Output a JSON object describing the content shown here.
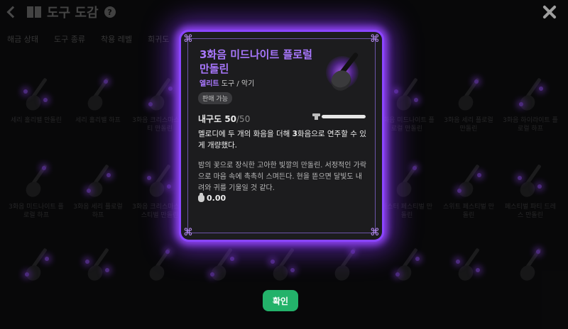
{
  "header": {
    "title": "도구 도감",
    "help_icon": "help-circle-icon",
    "back_icon": "chevron-left-icon",
    "close_icon": "close-icon"
  },
  "filters": [
    "해금 상태",
    "도구 종류",
    "착용 레벨",
    "희귀도"
  ],
  "grid": {
    "rows": [
      [
        "세리 홀리밸 만돌린",
        "세리 홀리밸 하프",
        "3화음 크리스마스 파티 만돌린",
        "",
        "",
        "",
        "3화음 미드나이트 플로럴 만돌린",
        "3화음 세리 플로럴 만돌린",
        "3화음 하이라이트 플로럴 하프"
      ],
      [
        "3화음 미드나이트 플로럴 하프",
        "3화음 세리 플로럴 하프",
        "3화음 크리스마스 페스티벌 만돌린",
        "",
        "",
        "",
        "마스터 페스티벌 만돌린",
        "스위트 페스티벌 만돌린",
        "페스티벌 파티 드레스 만돌린"
      ],
      [
        "",
        "",
        "",
        "",
        "",
        "",
        "",
        "",
        ""
      ]
    ]
  },
  "item": {
    "name": "3화음 미드나이트 플로럴 만돌린",
    "grade": "엘리트",
    "category_rest": " 도구 / 악기",
    "sell_badge": "판매 가능",
    "durability_label": "내구도 ",
    "durability_current": "50",
    "durability_max": "/50",
    "durability_fraction": 1.0,
    "desc1_pre": "멜로디에 두 개의 화음을 더해 ",
    "desc1_bold": "3",
    "desc1_post": "화음으로 연주할 수 있게 개량했다.",
    "desc2": "밤의 꽃으로 장식한 고아한 빛깔의 만돌린. 서정적인 가락으로 마음 속에 촉촉히 스며든다. 현을 뜯으면 달빛도 내려와 귀를 기울일 것 같다.",
    "price": "0.00",
    "accent_color": "#8a45ff"
  },
  "confirm_label": "확인"
}
